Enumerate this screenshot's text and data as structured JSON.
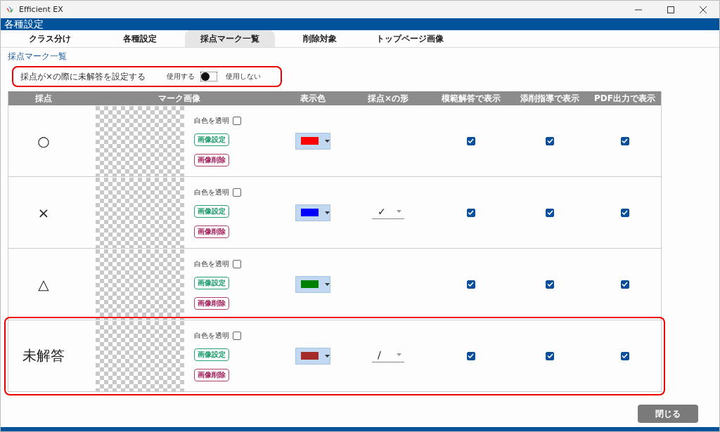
{
  "window": {
    "title": "Efficient EX"
  },
  "header": {
    "title": "各種設定"
  },
  "tabs": [
    {
      "label": "クラス分け",
      "selected": false
    },
    {
      "label": "各種設定",
      "selected": false
    },
    {
      "label": "採点マーク一覧",
      "selected": true
    },
    {
      "label": "削除対象",
      "selected": false
    },
    {
      "label": "トップページ画像",
      "selected": false
    }
  ],
  "section_title": "採点マーク一覧",
  "setting": {
    "label": "採点が×の際に未解答を設定する",
    "on_label": "使用する",
    "off_label": "使用しない",
    "on": false,
    "highlighted": true
  },
  "table": {
    "columns": [
      "採点",
      "マーク画像",
      "表示色",
      "採点×の形",
      "模範解答で表示",
      "添削指導で表示",
      "PDF出力で表示"
    ],
    "rows": [
      {
        "mark": "○",
        "transparent_label": "白色を透明",
        "transparent": false,
        "set_button": "画像設定",
        "delete_button": "画像削除",
        "color": "#ff0000",
        "shape": null,
        "model": true,
        "correction": true,
        "pdf": true,
        "highlighted": false
      },
      {
        "mark": "×",
        "transparent_label": "白色を透明",
        "transparent": false,
        "set_button": "画像設定",
        "delete_button": "画像削除",
        "color": "#0000ff",
        "shape": "✓",
        "model": true,
        "correction": true,
        "pdf": true,
        "highlighted": false
      },
      {
        "mark": "△",
        "transparent_label": "白色を透明",
        "transparent": false,
        "set_button": "画像設定",
        "delete_button": "画像削除",
        "color": "#008000",
        "shape": null,
        "model": true,
        "correction": true,
        "pdf": true,
        "highlighted": false
      },
      {
        "mark": "未解答",
        "transparent_label": "白色を透明",
        "transparent": false,
        "set_button": "画像設定",
        "delete_button": "画像削除",
        "color": "#a52a2a",
        "shape": "/",
        "model": true,
        "correction": true,
        "pdf": true,
        "highlighted": true
      }
    ]
  },
  "close_button": "閉じる"
}
